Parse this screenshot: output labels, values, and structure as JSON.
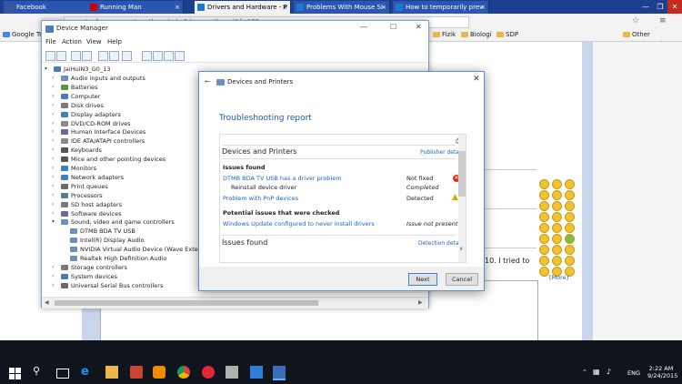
{
  "browser": {
    "tabs": [
      {
        "label": "Facebook",
        "color": "#3b5998"
      },
      {
        "label": "Running Man",
        "color": "#cc0000"
      },
      {
        "label": "Drivers and Hardware - P",
        "color": "#1f78d1"
      },
      {
        "label": "Problems With Mouse Si",
        "color": "#1f78d1"
      },
      {
        "label": "How to temporarily prev",
        "color": "#1f78d1"
      }
    ],
    "url": "www.tenforums.com/newthread.php?do=newthread&f=125",
    "bookmarks_start": "Google Tr",
    "bookmarks": [
      "Fizik",
      "Biologi",
      "SDP"
    ],
    "other_bookmarks": "Other bookmarks"
  },
  "site": {
    "text_fragment": "10. I tried to",
    "more_link": "[More]"
  },
  "device_manager": {
    "title": "Device Manager",
    "menu": [
      "File",
      "Action",
      "View",
      "Help"
    ],
    "root": "JaiHuiN3_G0_13",
    "categories": [
      {
        "label": "Audio inputs and outputs",
        "color": "#6d8fbf"
      },
      {
        "label": "Batteries",
        "color": "#5a9a46"
      },
      {
        "label": "Computer",
        "color": "#4a7bc0"
      },
      {
        "label": "Disk drives",
        "color": "#7a7a7a"
      },
      {
        "label": "Display adapters",
        "color": "#3b82c4"
      },
      {
        "label": "DVD/CD-ROM drives",
        "color": "#8a8a8a"
      },
      {
        "label": "Human Interface Devices",
        "color": "#6a6a9a"
      },
      {
        "label": "IDE ATA/ATAPI controllers",
        "color": "#8a8a8a"
      },
      {
        "label": "Keyboards",
        "color": "#555555"
      },
      {
        "label": "Mice and other pointing devices",
        "color": "#555555"
      },
      {
        "label": "Monitors",
        "color": "#3b82c4"
      },
      {
        "label": "Network adapters",
        "color": "#3b82c4"
      },
      {
        "label": "Print queues",
        "color": "#6a6a6a"
      },
      {
        "label": "Processors",
        "color": "#5a7a9a"
      },
      {
        "label": "SD host adapters",
        "color": "#7a7a7a"
      },
      {
        "label": "Software devices",
        "color": "#6a6a9a"
      },
      {
        "label": "Sound, video and game controllers",
        "color": "#6d8fbf"
      }
    ],
    "sound_children": [
      "DTMB BDA TV USB",
      "Intel(R) Display Audio",
      "NVIDIA Virtual Audio Device (Wave Extensible",
      "Realtek High Definition Audio"
    ],
    "bottom_categories": [
      {
        "label": "Storage controllers",
        "color": "#7a7a7a"
      },
      {
        "label": "System devices",
        "color": "#4a7bc0"
      },
      {
        "label": "Universal Serial Bus controllers",
        "color": "#6a6a6a"
      }
    ]
  },
  "dialog": {
    "title": "Devices and Printers",
    "heading": "Troubleshooting report",
    "section1": "Devices and Printers",
    "publisher_link": "Publisher details",
    "issues_found_label": "Issues found",
    "issues": [
      {
        "name": "DTMB BDA TV USB has a driver problem",
        "status": "Not fixed",
        "kind": "error"
      },
      {
        "name": "Reinstall device driver",
        "status": "Completed",
        "kind": "none"
      },
      {
        "name": "Problem with PnP devices",
        "status": "Detected",
        "kind": "warning"
      }
    ],
    "checked_label": "Potential issues that were checked",
    "checked_item": "Windows Update configured to never install drivers",
    "checked_status": "Issue not present",
    "section2": "Issues found",
    "detection_link": "Detection details",
    "next_button": "Next",
    "cancel_button": "Cancel"
  },
  "taskbar": {
    "time": "2:22 AM",
    "date": "9/24/2015",
    "language": "ENG"
  }
}
